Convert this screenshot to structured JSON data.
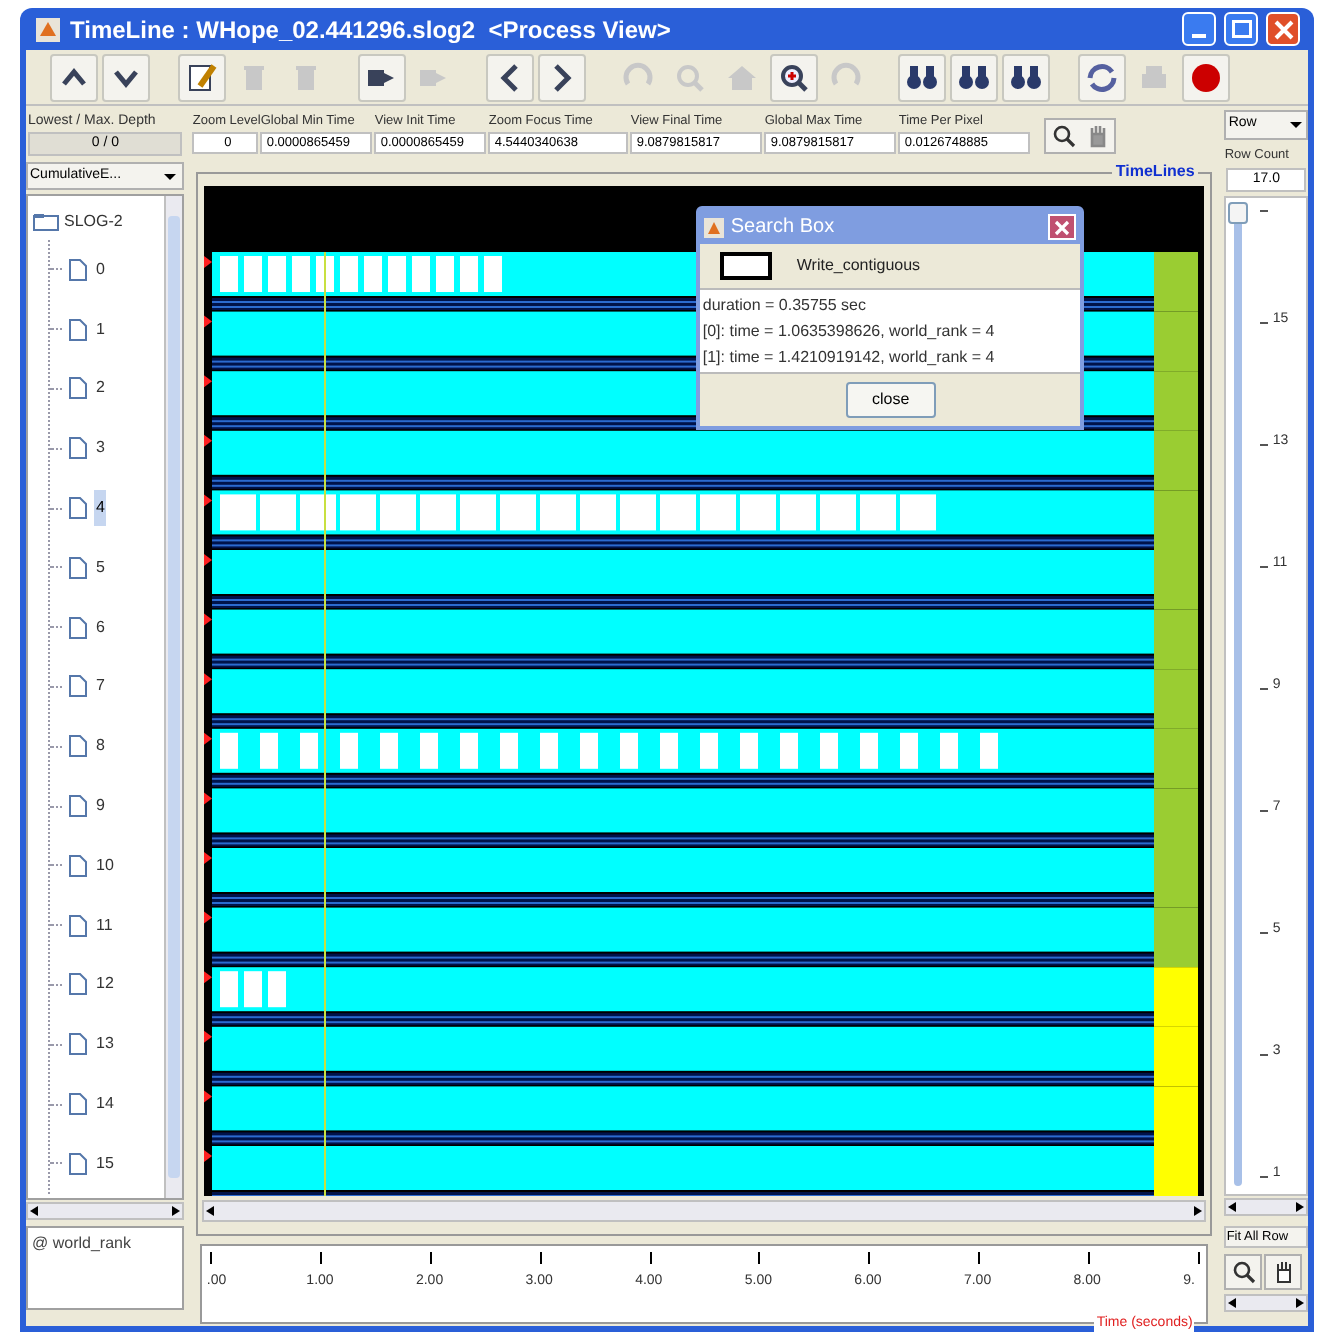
{
  "window": {
    "title": "TimeLine : WHope_02.441296.slog2  <Process View>"
  },
  "toolbar": [
    [
      {
        "disabled": false
      },
      {
        "disabled": false
      }
    ],
    [
      {
        "disabled": false
      },
      {
        "disabled": true
      },
      {
        "disabled": true
      }
    ],
    [
      {
        "disabled": false
      },
      {
        "disabled": true
      }
    ],
    [
      {
        "disabled": false
      },
      {
        "disabled": false
      }
    ],
    [
      {
        "disabled": true
      },
      {
        "disabled": true
      },
      {
        "disabled": true
      },
      {
        "disabled": false
      },
      {
        "disabled": true
      }
    ],
    [
      {
        "disabled": false
      },
      {
        "disabled": false
      },
      {
        "disabled": false
      }
    ],
    [
      {
        "disabled": false
      },
      {
        "disabled": true
      },
      {
        "disabled": false
      }
    ]
  ],
  "depth": {
    "label": "Lowest / Max. Depth",
    "value": "0 / 0"
  },
  "view_select": {
    "value": "CumulativeE..."
  },
  "info_fields": [
    {
      "label": "Zoom Level",
      "value": "0"
    },
    {
      "label": "Global Min Time",
      "value": "0.0000865459"
    },
    {
      "label": "View  Init Time",
      "value": "0.0000865459"
    },
    {
      "label": "Zoom Focus Time",
      "value": "4.5440340638"
    },
    {
      "label": "View Final Time",
      "value": "9.0879815817"
    },
    {
      "label": "Global Max Time",
      "value": "9.0879815817"
    },
    {
      "label": "Time Per Pixel",
      "value": "0.0126748885"
    }
  ],
  "tree": {
    "root": "SLOG-2",
    "children": [
      {
        "label": "0",
        "selected": false
      },
      {
        "label": "1",
        "selected": false
      },
      {
        "label": "2",
        "selected": false
      },
      {
        "label": "3",
        "selected": false
      },
      {
        "label": "4",
        "selected": true
      },
      {
        "label": "5",
        "selected": false
      },
      {
        "label": "6",
        "selected": false
      },
      {
        "label": "7",
        "selected": false
      },
      {
        "label": "8",
        "selected": false
      },
      {
        "label": "9",
        "selected": false
      },
      {
        "label": "10",
        "selected": false
      },
      {
        "label": "11",
        "selected": false
      },
      {
        "label": "12",
        "selected": false
      },
      {
        "label": "13",
        "selected": false
      },
      {
        "label": "14",
        "selected": false
      },
      {
        "label": "15",
        "selected": false
      }
    ]
  },
  "attribute": {
    "label": "@ world_rank"
  },
  "canvas": {
    "title": "TimeLines"
  },
  "axis": {
    "labels": [
      ".00",
      "1.00",
      "2.00",
      "3.00",
      "4.00",
      "5.00",
      "6.00",
      "7.00",
      "8.00",
      "9."
    ],
    "title": "Time (seconds)"
  },
  "search_box": {
    "title": "Search Box",
    "category": "Write_contiguous",
    "lines": [
      "duration = 0.35755 sec",
      "[0]: time = 1.0635398626, world_rank = 4",
      "[1]: time = 1.4210919142, world_rank = 4"
    ],
    "button": "close"
  },
  "row_panel": {
    "mode": "Row",
    "count_label": "Row Count",
    "count": "17.0",
    "scale": {
      "level": 1,
      "labels": [
        "15",
        "13",
        "11",
        "9",
        "7",
        "5",
        "3",
        "1"
      ]
    },
    "fit_button": "Fit All Row"
  }
}
